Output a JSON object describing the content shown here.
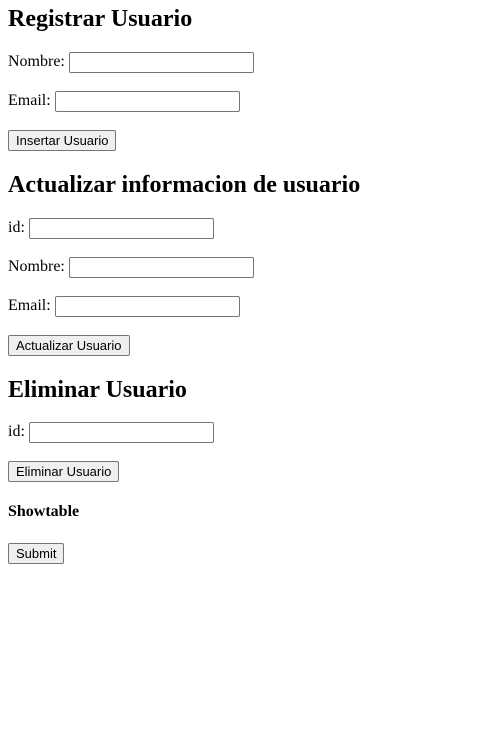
{
  "register": {
    "title": "Registrar Usuario",
    "name_label": "Nombre:",
    "name_value": "",
    "email_label": "Email:",
    "email_value": "",
    "submit_label": "Insertar Usuario"
  },
  "update": {
    "title": "Actualizar informacion de usuario",
    "id_label": "id:",
    "id_value": "",
    "name_label": "Nombre:",
    "name_value": "",
    "email_label": "Email:",
    "email_value": "",
    "submit_label": "Actualizar Usuario"
  },
  "delete": {
    "title": "Eliminar Usuario",
    "id_label": "id:",
    "id_value": "",
    "submit_label": "Eliminar Usuario"
  },
  "showtable": {
    "title": "Showtable",
    "submit_label": "Submit"
  }
}
